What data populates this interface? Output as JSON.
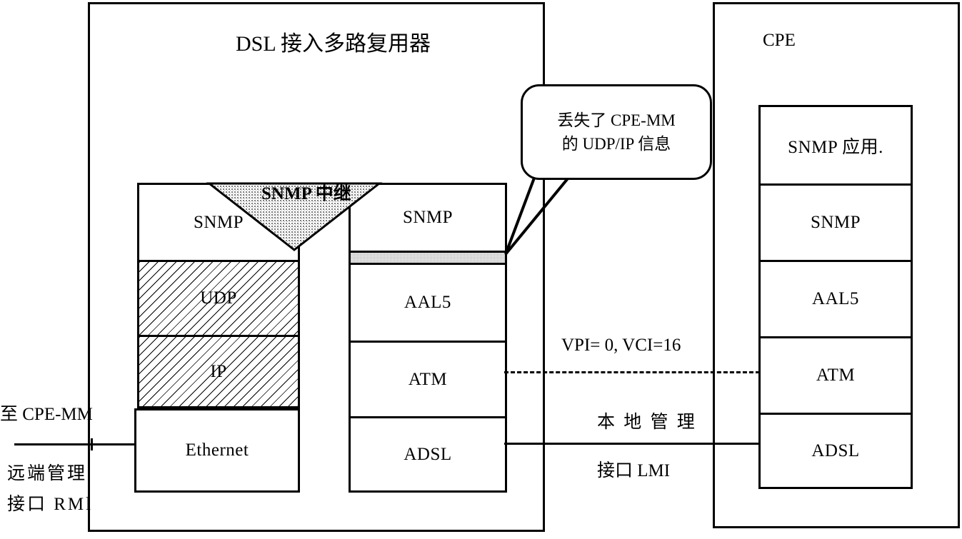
{
  "diagram": {
    "dslam": {
      "title": "DSL 接入多路复用器",
      "left_stack": [
        {
          "label": "SNMP",
          "fill": "white"
        },
        {
          "label": "UDP",
          "fill": "hatch"
        },
        {
          "label": "IP",
          "fill": "hatch"
        }
      ],
      "ethernet": {
        "label": "Ethernet",
        "fill": "white"
      },
      "relay": {
        "label": "SNMP 中继",
        "shape": "down-triangle",
        "fill": "stipple-grey"
      },
      "right_stack": [
        {
          "label": "SNMP",
          "fill": "white"
        },
        {
          "label": "",
          "fill": "stipple-grey-band"
        },
        {
          "label": "AAL5",
          "fill": "white"
        },
        {
          "label": "ATM",
          "fill": "white"
        },
        {
          "label": "ADSL",
          "fill": "white"
        }
      ]
    },
    "cpe": {
      "title": "CPE",
      "stack": [
        {
          "label": "SNMP 应用."
        },
        {
          "label": "SNMP"
        },
        {
          "label": "AAL5"
        },
        {
          "label": "ATM"
        },
        {
          "label": "ADSL"
        }
      ]
    },
    "callout": {
      "line1": "丢失了  CPE-MM",
      "line2": "的 UDP/IP 信息"
    },
    "labels": {
      "to_cpe_mm": "至 CPE-MM",
      "rmi_line1": "远端管理",
      "rmi_line2": "接口 RMl",
      "vpi_vci": "VPI= 0, VCI=16",
      "lmi_line1": "本 地 管 理",
      "lmi_line2": "接口 LMI"
    },
    "colors": {
      "stroke": "#000000",
      "background": "#ffffff",
      "stipple_grey": "#b9b9b9"
    }
  }
}
